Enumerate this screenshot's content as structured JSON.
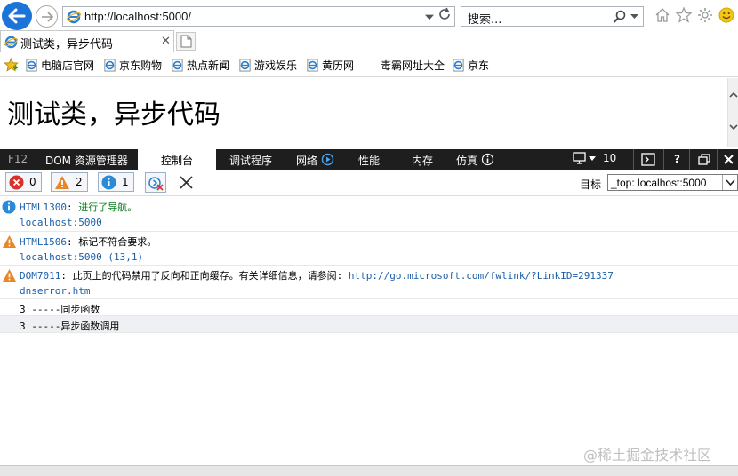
{
  "address": {
    "url": "http://localhost:5000/",
    "search_placeholder": "搜索..."
  },
  "tab": {
    "title": "测试类，异步代码"
  },
  "favorites": [
    "电脑店官网",
    "京东购物",
    "热点新闻",
    "游戏娱乐",
    "黄历网",
    "毒霸网址大全",
    "京东"
  ],
  "page": {
    "heading": "测试类，异步代码"
  },
  "devtools": {
    "tabs": {
      "f12": "F12",
      "dom": "DOM 资源管理器",
      "console": "控制台",
      "debugger": "调试程序",
      "network": "网络",
      "performance": "性能",
      "memory": "内存",
      "emulation": "仿真"
    },
    "emulation_count": "10",
    "help": "?",
    "filters": {
      "errors": "0",
      "warnings": "2",
      "info": "1"
    },
    "target_label": "目标",
    "target_value": "_top: localhost:5000"
  },
  "console": {
    "m1": {
      "code": "HTML1300",
      "sep": ": ",
      "text": "进行了导航。",
      "src": "localhost:5000"
    },
    "m2": {
      "code": "HTML1506",
      "sep": ": ",
      "text": "标记不符合要求。",
      "src": "localhost:5000 (13,1)"
    },
    "m3": {
      "code": "DOM7011",
      "sep": ": ",
      "text": "此页上的代码禁用了反向和正向缓存。有关详细信息，请参阅: ",
      "link": "http://go.microsoft.com/fwlink/?LinkID=291337",
      "src": "dnserror.htm"
    },
    "logs": [
      "3 -----同步函数",
      "3 -----异步函数调用"
    ]
  },
  "watermark": "@稀土掘金技术社区",
  "colors": {
    "accent": "#1c73d8",
    "devbar": "#1e1e1e",
    "error": "#d9302c",
    "warning": "#e8862a",
    "info": "#2a8ad8"
  }
}
